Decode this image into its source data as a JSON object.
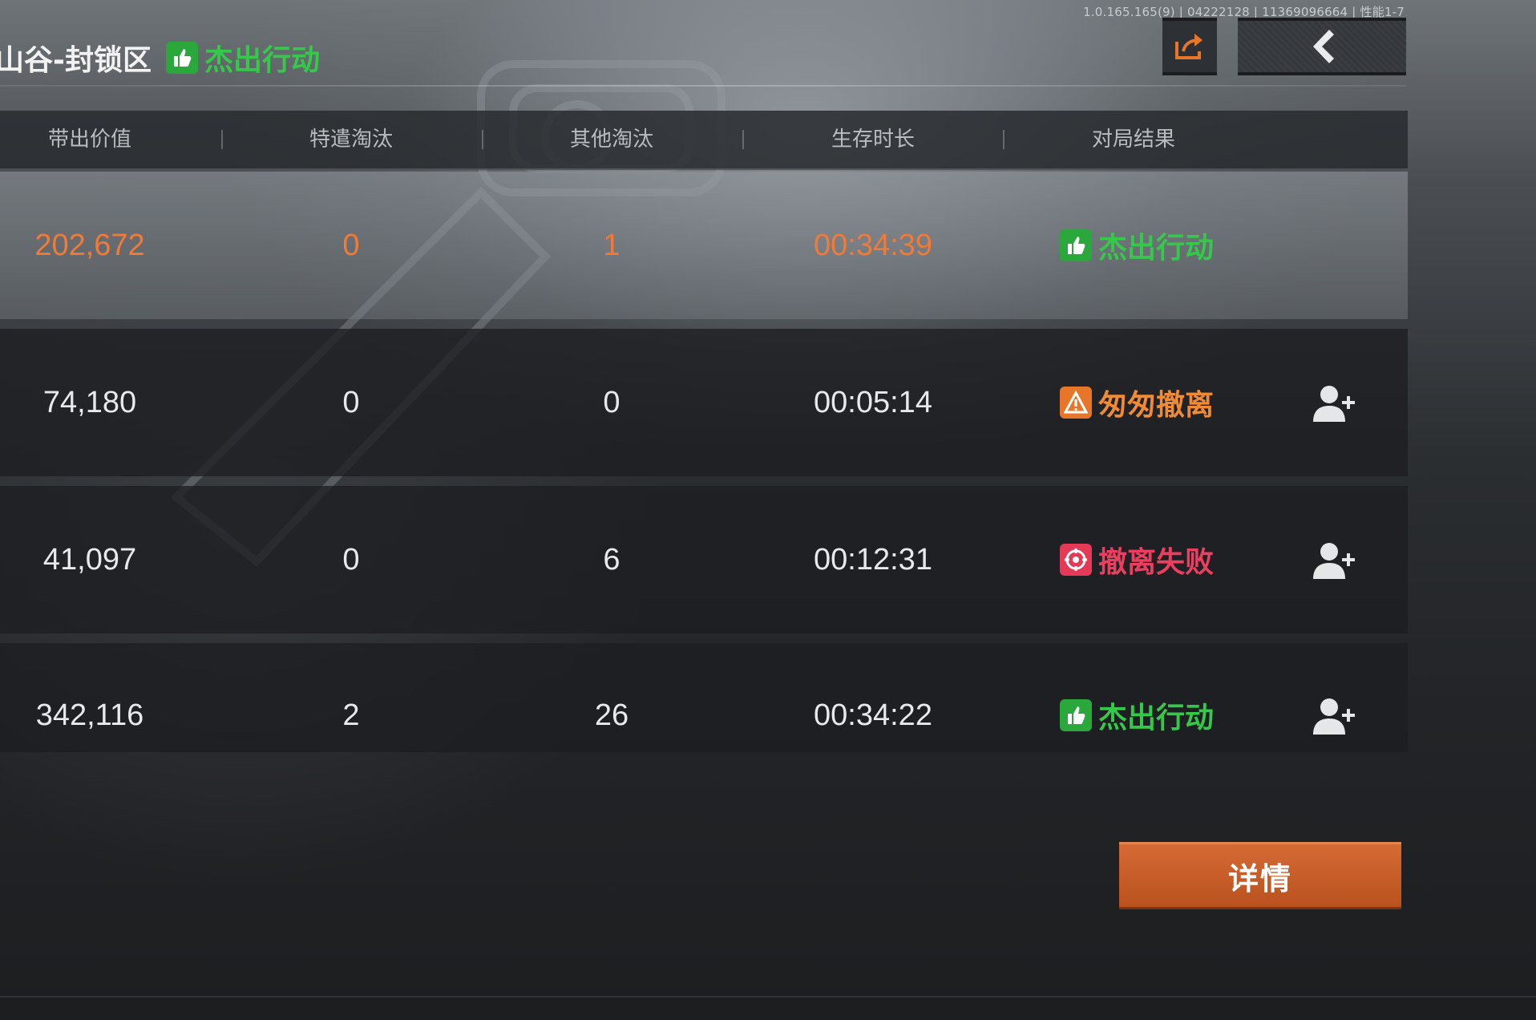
{
  "version_text": "1.0.165.165(9) | 04222128 | 11369096664 | 性能1-7",
  "header": {
    "map_title": "山谷-封锁区",
    "overall_result": {
      "label": "杰出行动",
      "icon": "thumbs-up-icon",
      "color": "#35c94a"
    }
  },
  "buttons": {
    "share_icon": "share-icon",
    "back_icon": "chevron-left-icon",
    "details_label": "详情"
  },
  "table": {
    "columns": [
      "带出价值",
      "特遣淘汰",
      "其他淘汰",
      "生存时长",
      "对局结果"
    ],
    "rows": [
      {
        "value": "202,672",
        "special_kills": "0",
        "other_kills": "1",
        "survival": "00:34:39",
        "result": "杰出行动",
        "result_type": "green",
        "is_self": true
      },
      {
        "value": "74,180",
        "special_kills": "0",
        "other_kills": "0",
        "survival": "00:05:14",
        "result": "匆匆撤离",
        "result_type": "orange",
        "is_self": false
      },
      {
        "value": "41,097",
        "special_kills": "0",
        "other_kills": "6",
        "survival": "00:12:31",
        "result": "撤离失败",
        "result_type": "red",
        "is_self": false
      },
      {
        "value": "342,116",
        "special_kills": "2",
        "other_kills": "26",
        "survival": "00:34:22",
        "result": "杰出行动",
        "result_type": "green",
        "is_self": false
      }
    ]
  },
  "colors": {
    "highlight": "#f07a38",
    "success": "#35c94a",
    "warning": "#f08a35",
    "fail": "#ec3e5e",
    "details_button": "#c85e28"
  }
}
